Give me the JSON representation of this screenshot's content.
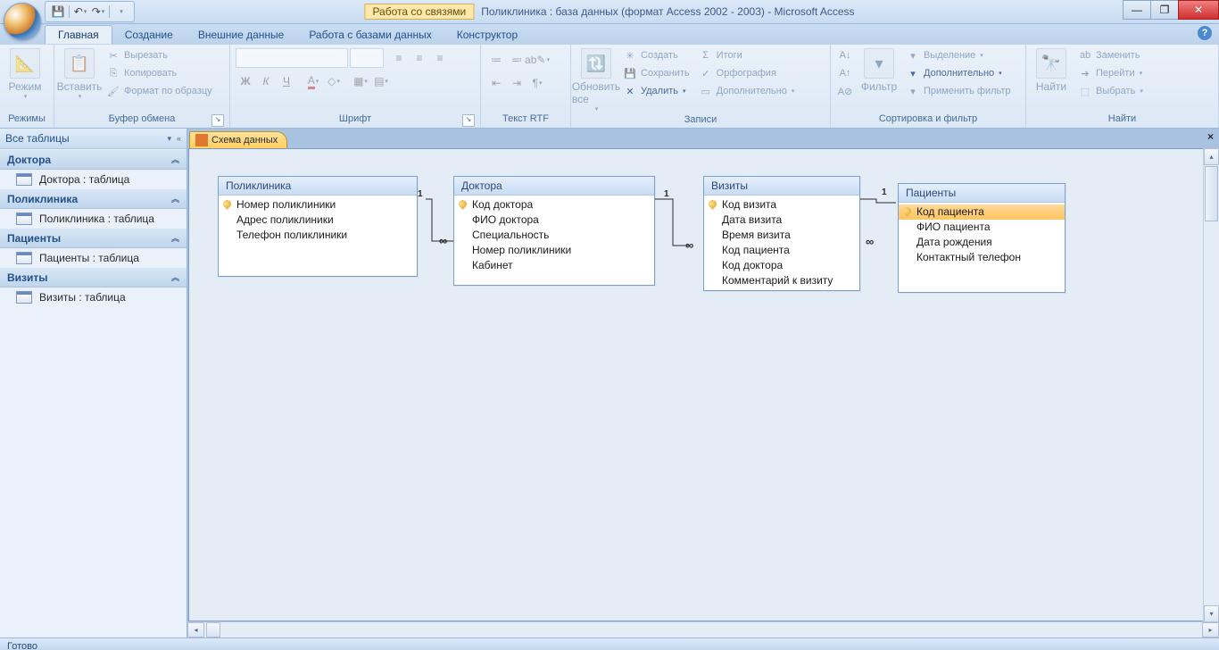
{
  "titlebar": {
    "context_tab": "Работа со связями",
    "window_title": "Поликлиника : база данных (формат Access 2002 - 2003) - Microsoft Access"
  },
  "tabs": {
    "t0": "Главная",
    "t1": "Создание",
    "t2": "Внешние данные",
    "t3": "Работа с базами данных",
    "t4": "Конструктор"
  },
  "ribbon": {
    "modes": {
      "label": "Режимы",
      "btn": "Режим"
    },
    "clipboard": {
      "label": "Буфер обмена",
      "paste": "Вставить",
      "cut": "Вырезать",
      "copy": "Копировать",
      "fmt": "Формат по образцу"
    },
    "font": {
      "label": "Шрифт"
    },
    "rtf": {
      "label": "Текст RTF"
    },
    "records": {
      "label": "Записи",
      "refresh": "Обновить все",
      "create": "Создать",
      "save": "Сохранить",
      "delete": "Удалить",
      "totals": "Итоги",
      "spelling": "Орфография",
      "more": "Дополнительно"
    },
    "sort": {
      "label": "Сортировка и фильтр",
      "filter": "Фильтр",
      "selection": "Выделение",
      "advanced": "Дополнительно",
      "toggle": "Применить фильтр"
    },
    "find": {
      "label": "Найти",
      "find": "Найти",
      "replace": "Заменить",
      "goto": "Перейти",
      "select": "Выбрать"
    }
  },
  "nav": {
    "header": "Все таблицы",
    "groups": [
      {
        "name": "Доктора",
        "items": [
          "Доктора : таблица"
        ]
      },
      {
        "name": "Поликлиника",
        "items": [
          "Поликлиника : таблица"
        ]
      },
      {
        "name": "Пациенты",
        "items": [
          "Пациенты : таблица"
        ]
      },
      {
        "name": "Визиты",
        "items": [
          "Визиты : таблица"
        ]
      }
    ]
  },
  "doc_tab": "Схема данных",
  "tables": {
    "poliklinika": {
      "title": "Поликлиника",
      "fields": [
        "Номер поликлиники",
        "Адрес поликлиники",
        "Телефон поликлиники"
      ],
      "pk": [
        0
      ]
    },
    "doktora": {
      "title": "Доктора",
      "fields": [
        "Код доктора",
        "ФИО доктора",
        "Специальность",
        "Номер поликлиники",
        "Кабинет"
      ],
      "pk": [
        0
      ]
    },
    "vizity": {
      "title": "Визиты",
      "fields": [
        "Код визита",
        "Дата визита",
        "Время визита",
        "Код пациента",
        "Код доктора",
        "Комментарий к визиту"
      ],
      "pk": [
        0
      ]
    },
    "pacienty": {
      "title": "Пациенты",
      "fields": [
        "Код пациента",
        "ФИО пациента",
        "Дата рождения",
        "Контактный телефон"
      ],
      "pk": [
        0
      ],
      "selected": 0
    }
  },
  "rel": {
    "one": "1",
    "many": "∞"
  },
  "status": "Готово"
}
